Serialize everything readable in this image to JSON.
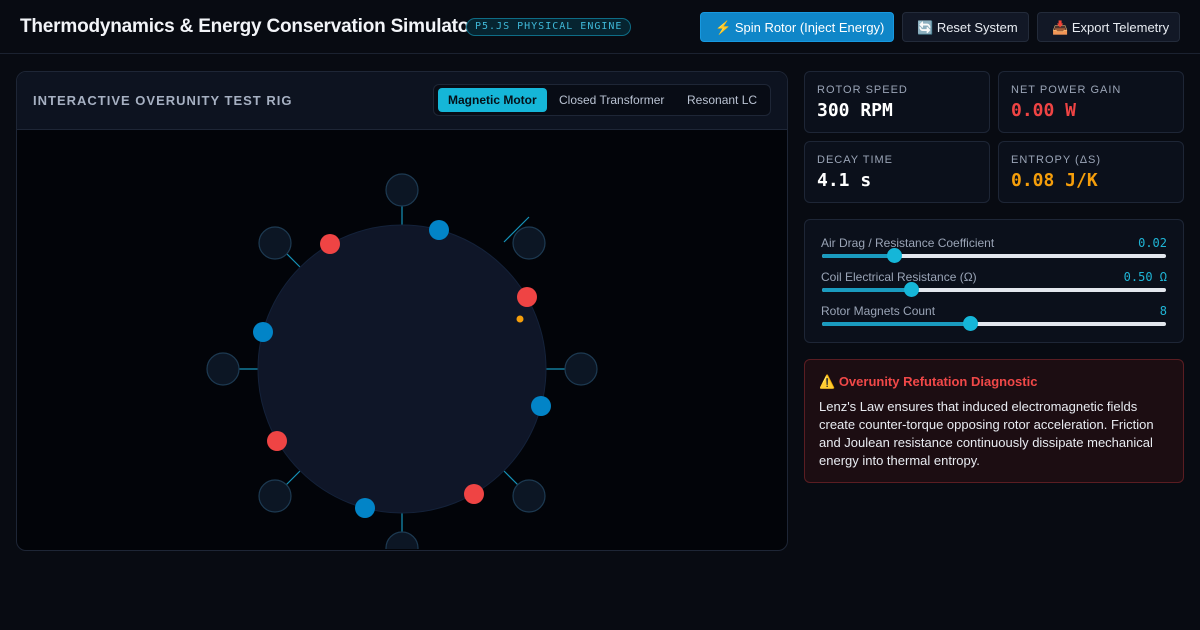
{
  "header": {
    "title": "Thermodynamics & Energy Conservation Simulator",
    "engine_badge": "P5.JS PHYSICAL ENGINE",
    "buttons": {
      "spin": {
        "icon": "⚡",
        "label": "Spin Rotor (Inject Energy)"
      },
      "reset": {
        "icon": "🔄",
        "label": "Reset System"
      },
      "export": {
        "icon": "📥",
        "label": "Export Telemetry"
      }
    }
  },
  "rig": {
    "title": "INTERACTIVE OVERUNITY TEST RIG",
    "tabs": [
      {
        "label": "Magnetic Motor",
        "active": true
      },
      {
        "label": "Closed Transformer",
        "active": false
      },
      {
        "label": "Resonant LC",
        "active": false
      }
    ]
  },
  "stats": {
    "rotor_speed": {
      "label": "ROTOR SPEED",
      "value": "300 RPM",
      "color": "#ffffff"
    },
    "net_power_gain": {
      "label": "NET POWER GAIN",
      "value": "0.00 W",
      "color": "#ef4444"
    },
    "decay_time": {
      "label": "DECAY TIME",
      "value": "4.1 s",
      "color": "#ffffff"
    },
    "entropy": {
      "label": "ENTROPY (ΔS)",
      "value": "0.08 J/K",
      "color": "#f59e0b"
    }
  },
  "sliders": [
    {
      "label": "Air Drag / Resistance Coefficient",
      "value": "0.02",
      "level": 0.21
    },
    {
      "label": "Coil Electrical Resistance (Ω)",
      "value": "0.50 Ω",
      "level": 0.26
    },
    {
      "label": "Rotor Magnets Count",
      "value": "8",
      "level": 0.43
    }
  ],
  "diagnostic": {
    "icon": "⚠️",
    "title": "Overunity Refutation Diagnostic",
    "body": "Lenz's Law ensures that induced electromagnetic fields create counter-torque opposing rotor acceleration. Friction and Joulean resistance continuously dissipate mechanical energy into thermal entropy."
  },
  "colors": {
    "accent": "#15b6d8",
    "primary_button": "#0f86c8",
    "magnet_north": "#ef4444",
    "magnet_south": "#0284c7",
    "warning": "#f04848"
  }
}
